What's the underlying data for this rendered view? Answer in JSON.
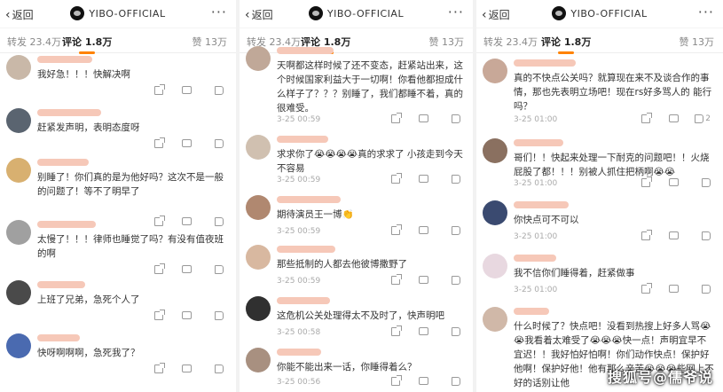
{
  "app": {
    "back_label": "返回",
    "title": "YIBO-OFFICIAL",
    "more_icon": "more-dots-icon",
    "forward_label": "转发 23.4万",
    "comment_label": "评论 1.8万",
    "like_label": "赞 13万",
    "accent": "#ff8200"
  },
  "panels": [
    {
      "comments": [
        {
          "text": "我好急！！！快解决啊",
          "time": "",
          "likes": "",
          "avatar_color": "#c9b8a8"
        },
        {
          "text": "赶紧发声明，表明态度呀",
          "time": "",
          "likes": "",
          "avatar_color": "#5a6470"
        },
        {
          "text": "别睡了！你们真的是为他好吗？这次不是一般的问题了！等不了明早了",
          "time": "",
          "likes": "",
          "avatar_color": "#d8b070"
        },
        {
          "text": "太慢了！！！律师也睡觉了吗？有没有值夜班的啊",
          "time": "",
          "likes": "",
          "avatar_color": "#a0a0a0"
        },
        {
          "text": "上班了兄弟，急死个人了",
          "time": "",
          "likes": "",
          "avatar_color": "#4a4a4a"
        },
        {
          "text": "快呀啊啊啊，急死我了？",
          "time": "",
          "likes": "",
          "avatar_color": "#4a6ab0"
        }
      ]
    },
    {
      "comments": [
        {
          "text": "天啊都这样时候了还不变态，赶紧站出来，这个时候国家利益大于一切啊！你看他都担成什么样子了？？？别睡了，我们都睡不着，真的很难受。",
          "time": "3-25 00:59",
          "likes": "",
          "avatar_color": "#c0a898"
        },
        {
          "text": "求求你了😭😭😭😭真的求求了 小孩走到今天不容易",
          "time": "3-25 00:59",
          "likes": "",
          "avatar_color": "#d0c0b0"
        },
        {
          "text": "期待演员王一博👏",
          "time": "3-25 00:59",
          "likes": "",
          "avatar_color": "#b08870"
        },
        {
          "text": "那些抵制的人都去他彼博撒野了",
          "time": "3-25 00:59",
          "likes": "",
          "avatar_color": "#d8b8a0"
        },
        {
          "text": "这危机公关处理得太不及时了，快声明吧",
          "time": "3-25 00:58",
          "likes": "",
          "avatar_color": "#303030"
        },
        {
          "text": "你能不能出来一话，你睡得着么？",
          "time": "3-25 00:56",
          "likes": "",
          "avatar_color": "#a89080"
        }
      ]
    },
    {
      "comments": [
        {
          "text": "真的不快点公关吗？就算现在来不及谈合作的事情，那也先表明立场吧！现在rs好多骂人的 能行吗？",
          "time": "3-25 01:00",
          "likes": "2",
          "avatar_color": "#c8a898"
        },
        {
          "text": "哥们！！快起来处理一下耐克的问题吧！！火烧屁股了都！！！别被人抓住把柄啊😭😭",
          "time": "3-25 01:00",
          "likes": "",
          "avatar_color": "#8a7060"
        },
        {
          "text": "你快点可不可以",
          "time": "3-25 01:00",
          "likes": "",
          "avatar_color": "#3a4a70"
        },
        {
          "text": "我不信你们睡得着，赶紧做事",
          "time": "3-25 01:00",
          "likes": "",
          "avatar_color": "#e8d8e0"
        },
        {
          "text": "什么时候了？快点吧！没看到热搜上好多人骂😭😭我看着太难受了😭😭😭快一点！声明宜早不宜迟！！我好怕好怕啊！你们动作快点！保护好他啊！保护好他！他有那么辛苦😭😭😭些网上不好的话别让他",
          "time": "",
          "likes": "",
          "avatar_color": "#d0b8a8"
        }
      ]
    }
  ],
  "watermark": "搜狐号@儒爷说"
}
